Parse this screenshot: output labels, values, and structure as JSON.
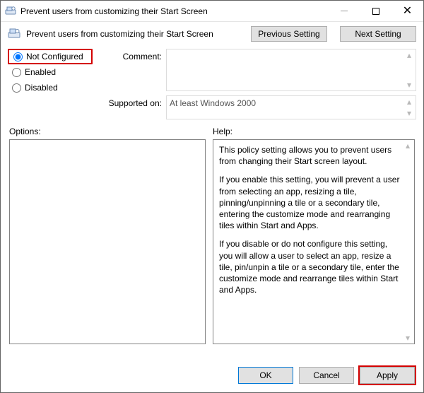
{
  "window": {
    "title": "Prevent users from customizing their Start Screen"
  },
  "header": {
    "policy_title": "Prevent users from customizing their Start Screen",
    "previous": "Previous Setting",
    "next": "Next Setting"
  },
  "config": {
    "not_configured": "Not Configured",
    "enabled": "Enabled",
    "disabled": "Disabled",
    "selected": "not_configured",
    "comment_label": "Comment:",
    "comment_value": "",
    "supported_label": "Supported on:",
    "supported_value": "At least Windows 2000"
  },
  "sections": {
    "options_label": "Options:",
    "help_label": "Help:"
  },
  "help": {
    "p1": "This policy setting allows you to prevent users from changing their Start screen layout.",
    "p2": "If you enable this setting, you will prevent a user from selecting an app, resizing a tile, pinning/unpinning a tile or a secondary tile, entering the customize mode and rearranging tiles within Start and Apps.",
    "p3": "If you disable or do not configure this setting, you will allow a user to select an app, resize a tile, pin/unpin a tile or a secondary tile, enter the customize mode and rearrange tiles within Start and Apps."
  },
  "footer": {
    "ok": "OK",
    "cancel": "Cancel",
    "apply": "Apply"
  }
}
